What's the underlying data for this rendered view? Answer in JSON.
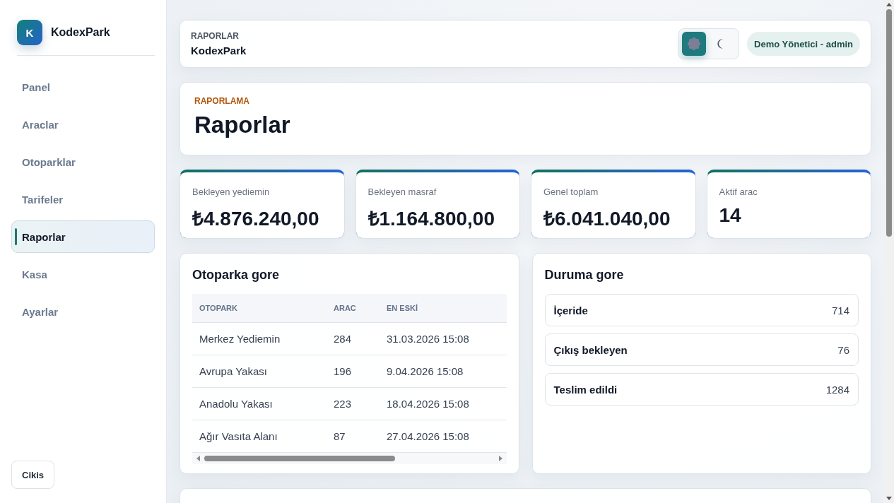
{
  "sidebar": {
    "logo_letter": "K",
    "app_name": "KodexPark",
    "items": [
      {
        "label": "Panel",
        "selected": false
      },
      {
        "label": "Araclar",
        "selected": false
      },
      {
        "label": "Otoparklar",
        "selected": false
      },
      {
        "label": "Tarifeler",
        "selected": false
      },
      {
        "label": "Raporlar",
        "selected": true
      },
      {
        "label": "Kasa",
        "selected": false
      },
      {
        "label": "Ayarlar",
        "selected": false
      }
    ],
    "logout": "Cikis"
  },
  "topbar": {
    "eyebrow": "RAPORLAR",
    "title": "KodexPark",
    "theme": [
      {
        "kind": "light",
        "selected": true
      },
      {
        "kind": "dark",
        "selected": false
      }
    ],
    "user": "Demo Yönetici - admin"
  },
  "hero": {
    "eyebrow": "RAPORLAMA",
    "title": "Raporlar"
  },
  "stats": [
    {
      "label": "Bekleyen yediemin",
      "value": "₺4.876.240,00"
    },
    {
      "label": "Bekleyen masraf",
      "value": "₺1.164.800,00"
    },
    {
      "label": "Genel toplam",
      "value": "₺6.041.040,00"
    },
    {
      "label": "Aktif arac",
      "value": "14"
    }
  ],
  "by_lot": {
    "title": "Otoparka gore",
    "table": {
      "columns": [
        "OTOPARK",
        "ARAC",
        "EN ESKİ"
      ],
      "rows": [
        [
          "Merkez Yediemin",
          "284",
          "31.03.2026 15:08"
        ],
        [
          "Avrupa Yakası",
          "196",
          "9.04.2026 15:08"
        ],
        [
          "Anadolu Yakası",
          "223",
          "18.04.2026 15:08"
        ],
        [
          "Ağır Vasıta Alanı",
          "87",
          "27.04.2026 15:08"
        ]
      ]
    }
  },
  "by_status": {
    "title": "Duruma gore",
    "items": [
      {
        "label": "İçeride",
        "count": "714"
      },
      {
        "label": "Çıkış bekleyen",
        "count": "76"
      },
      {
        "label": "Teslim edildi",
        "count": "1284"
      }
    ]
  }
}
